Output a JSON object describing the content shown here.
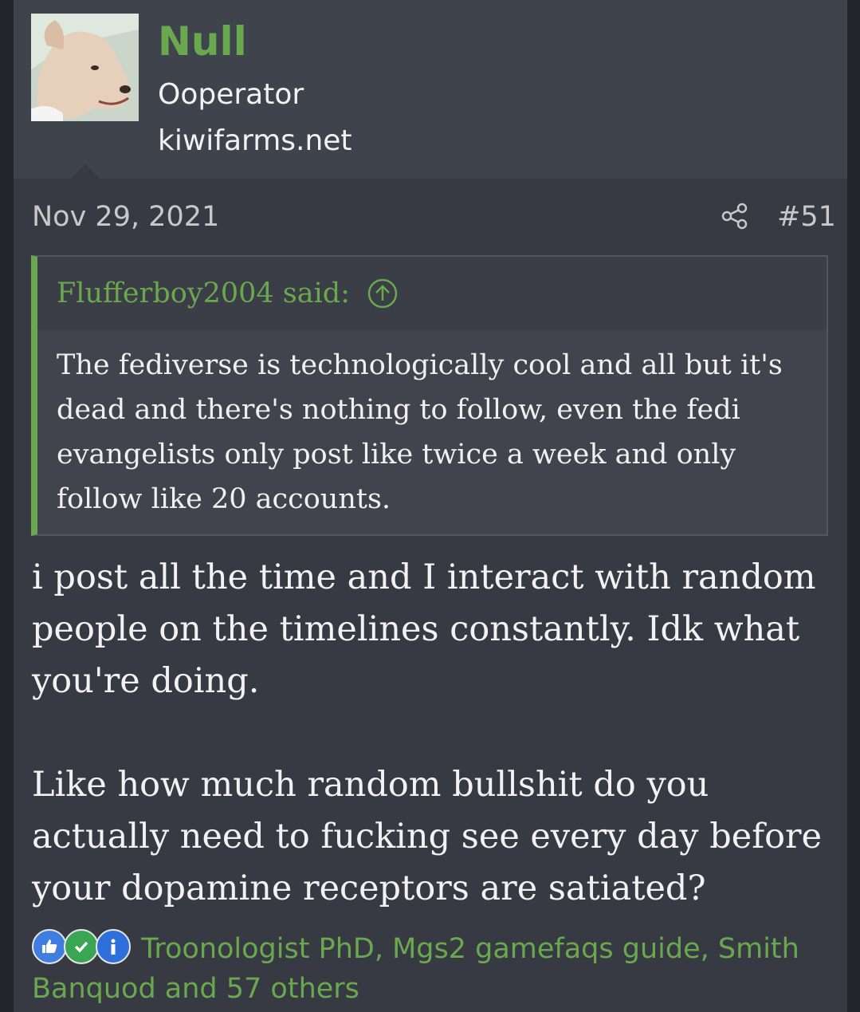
{
  "user": {
    "name": "Null",
    "title": "Ooperator",
    "banner": "kiwifarms.net"
  },
  "post": {
    "date": "Nov 29, 2021",
    "number": "#51"
  },
  "quote": {
    "author": "Flufferboy2004 said:",
    "text": "The fediverse is technologically cool and all but it's dead and there's nothing to follow, even the fedi evangelists only post like twice a week and only follow like 20 accounts."
  },
  "message": {
    "paragraph1": "i post all the time and I interact with random people on the timelines constantly. Idk what you're doing.",
    "paragraph2": "Like how much random bullshit do you actually need to fucking see every day before your dopamine receptors are satiated?"
  },
  "reactions": {
    "icons": [
      "thumbs-up-icon",
      "check-icon",
      "info-icon"
    ],
    "text": "Troonologist PhD, Mgs2 gamefaqs guide, Smith Banquod and 57 others"
  },
  "colors": {
    "accent": "#6aa84f",
    "background": "#373a42",
    "header": "#3f434b"
  }
}
